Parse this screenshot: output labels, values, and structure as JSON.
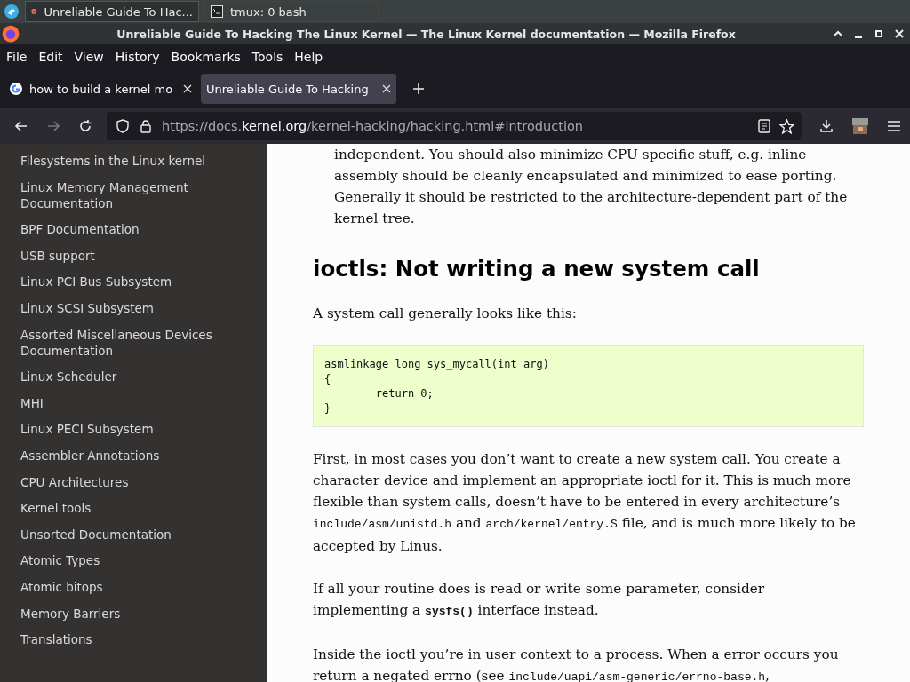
{
  "taskbar": {
    "tasks": [
      {
        "label": "Unreliable Guide To Hac...",
        "kind": "browser",
        "selected": true
      },
      {
        "label": "tmux: 0 bash",
        "kind": "terminal",
        "selected": false
      }
    ]
  },
  "window": {
    "title": "Unreliable Guide To Hacking The Linux Kernel — The Linux Kernel documentation — Mozilla Firefox"
  },
  "menu": [
    {
      "label": "File"
    },
    {
      "label": "Edit"
    },
    {
      "label": "View"
    },
    {
      "label": "History"
    },
    {
      "label": "Bookmarks"
    },
    {
      "label": "Tools"
    },
    {
      "label": "Help"
    }
  ],
  "tabs": [
    {
      "label": "how to build a kernel mo",
      "kind": "google",
      "selected": false
    },
    {
      "label": "Unreliable Guide To Hacking",
      "kind": "doc",
      "selected": true
    }
  ],
  "url": {
    "prefix": "https://docs.",
    "domain": "kernel.org",
    "path": "/kernel-hacking/hacking.html#introduction"
  },
  "sidebar": {
    "items": [
      "Filesystems in the Linux kernel",
      "Linux Memory Management Documentation",
      "BPF Documentation",
      "USB support",
      "Linux PCI Bus Subsystem",
      "Linux SCSI Subsystem",
      "Assorted Miscellaneous Devices Documentation",
      "Linux Scheduler",
      "MHI",
      "Linux PECI Subsystem",
      "Assembler Annotations",
      "CPU Architectures",
      "Kernel tools",
      "Unsorted Documentation",
      "Atomic Types",
      "Atomic bitops",
      "Memory Barriers",
      "Translations"
    ]
  },
  "content": [
    {
      "kind": "indented",
      "parts": [
        {
          "t": "independent. You should also minimize CPU specific stuff, e.g. inline assembly should be cleanly encapsulated and minimized to ease porting. Generally it should be restricted to the architecture-dependent part of the kernel tree.",
          "kind": "text"
        }
      ]
    },
    {
      "kind": "heading",
      "text": "ioctls: Not writing a new system call"
    },
    {
      "kind": "para",
      "parts": [
        {
          "t": "A system call generally looks like this:",
          "kind": "text"
        }
      ]
    },
    {
      "kind": "code",
      "lines": [
        "asmlinkage long sys_mycall(int arg)",
        "{",
        "        return 0;",
        "}"
      ]
    },
    {
      "kind": "para",
      "parts": [
        {
          "t": "First, in most cases you don’t want to create a new system call. You create a character device and implement an appropriate ioctl for it. This is much more flexible than system calls, doesn’t have to be entered in every architecture’s ",
          "kind": "text"
        },
        {
          "t": "include/asm/unistd.h",
          "kind": "code"
        },
        {
          "t": " and ",
          "kind": "text"
        },
        {
          "t": "arch/kernel/entry.S",
          "kind": "code"
        },
        {
          "t": " file, and is much more likely to be accepted by Linus.",
          "kind": "text"
        }
      ]
    },
    {
      "kind": "para",
      "parts": [
        {
          "t": "If all your routine does is read or write some parameter, consider implementing a ",
          "kind": "text"
        },
        {
          "t": "sysfs()",
          "kind": "boldcode"
        },
        {
          "t": " interface instead.",
          "kind": "text"
        }
      ]
    },
    {
      "kind": "para",
      "parts": [
        {
          "t": "Inside the ioctl you’re in user context to a process. When a error occurs you return a negated errno (see ",
          "kind": "text"
        },
        {
          "t": "include/uapi/asm-generic/errno-base.h",
          "kind": "code"
        },
        {
          "t": ",",
          "kind": "text"
        }
      ]
    }
  ]
}
